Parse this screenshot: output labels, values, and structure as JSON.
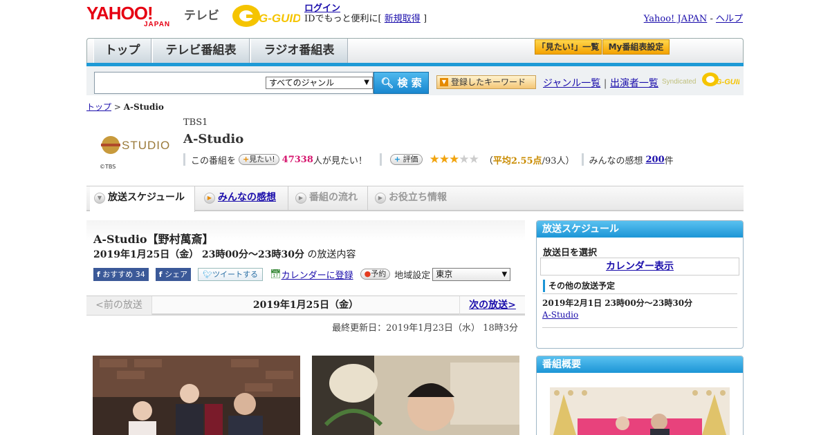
{
  "header": {
    "yahoo_logo_top": "YAHOO!",
    "yahoo_logo_sub": "JAPAN",
    "tv_label": "テレビ",
    "gguide_logo": "G-GUIDE",
    "login": "ログイン",
    "login_sub_prefix": "IDでもっと便利に[",
    "register": "新規取得",
    "login_sub_suffix": "]",
    "yahoo_japan_link": "Yahoo! JAPAN",
    "link_sep": "-",
    "help_link": "ヘルプ"
  },
  "nav": {
    "tabs": [
      "トップ",
      "テレビ番組表",
      "ラジオ番組表"
    ],
    "want_list": "「見たい!」一覧",
    "my_schedule": "My番組表設定"
  },
  "search": {
    "placeholder": "",
    "genre_selected": "すべてのジャンル",
    "button": "検 索",
    "keyword_button": "登録したキーワード",
    "genre_list": "ジャンル一覧",
    "sep": "|",
    "performer_list": "出演者一覧",
    "syndicated": "Syndicated"
  },
  "breadcrumb": {
    "top": "トップ",
    "sep": ">",
    "current": "A-Studio"
  },
  "program": {
    "logo_text": "STUDIO",
    "copyright": "©TBS",
    "channel": "TBS1",
    "title": "A-Studio",
    "want_prefix": "この番組を",
    "want_button": "見たい!",
    "want_count": "47338",
    "want_suffix": "人が見たい！",
    "rate_button": "評価",
    "rating": 2.55,
    "rating_open": "（",
    "rating_avg_label": "平均2.55点",
    "rating_voters": "/93人）",
    "impressions_label": "みんなの感想",
    "impressions_count": "200",
    "impressions_unit": "件"
  },
  "tabs": [
    {
      "label": "放送スケジュール",
      "state": "active"
    },
    {
      "label": "みんなの感想",
      "state": "link"
    },
    {
      "label": "番組の流れ",
      "state": "disabled"
    },
    {
      "label": "お役立ち情報",
      "state": "disabled"
    }
  ],
  "episode": {
    "title": "A-Studio【野村萬斎】",
    "date_time": "2019年1月25日（金） 23時00分～23時30分",
    "date_time_suffix": "の放送内容",
    "fb_recommend": "おすすめ",
    "fb_count": "34",
    "fb_share": "シェア",
    "tweet": "ツイートする",
    "calendar": "カレンダーに登録",
    "reserve": "予約",
    "region_label": "地域設定",
    "region_selected": "東京"
  },
  "pager": {
    "prev": "<前の放送",
    "date": "2019年1月25日（金）",
    "next": "次の放送>"
  },
  "updated": "最終更新日：2019年1月23日（水） 18時3分",
  "sidebar": {
    "schedule_head": "放送スケジュール",
    "select_date": "放送日を選択",
    "calendar_button": "カレンダー表示",
    "other_head": "その他の放送予定",
    "other_time": "2019年2月1日 23時00分～23時30分",
    "other_link": "A-Studio",
    "overview_head": "番組概要"
  },
  "colors": {
    "accent_blue": "#1e9ad6",
    "link": "#1a0dab",
    "yahoo_red": "#e60012",
    "want_pink": "#d6166e",
    "star": "#f1a40f"
  }
}
